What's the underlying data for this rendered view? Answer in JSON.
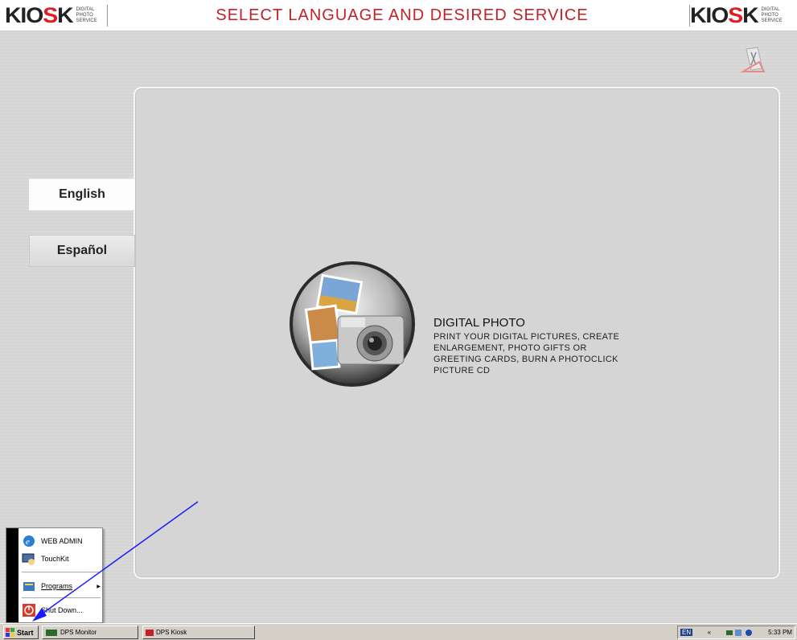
{
  "header": {
    "title": "SELECT LANGUAGE AND DESIRED SERVICE",
    "logo_word": "KIO",
    "logo_word_end": "K",
    "logo_sub": [
      "DIGITAL",
      "PHOTO",
      "SERVICE"
    ]
  },
  "languages": [
    {
      "label": "English",
      "selected": true
    },
    {
      "label": "Español",
      "selected": false
    }
  ],
  "service": {
    "title": "DIGITAL PHOTO",
    "description": "PRINT YOUR DIGITAL PICTURES, CREATE ENLARGEMENT, PHOTO GIFTS OR GREETING CARDS, BURN A PHOTOCLICK PICTURE CD"
  },
  "start_menu": {
    "items": [
      {
        "label": "WEB ADMIN",
        "icon": "ie-icon"
      },
      {
        "label": "TouchKit",
        "icon": "touchkit-icon"
      },
      {
        "label": "Programs",
        "icon": "programs-icon"
      },
      {
        "label": "Shut Down...",
        "icon": "shutdown-icon"
      }
    ]
  },
  "taskbar": {
    "start_label": "Start",
    "tasks": [
      "DPS Monitor",
      "DPS Kiosk"
    ],
    "lang_indicator": "EN",
    "clock": "5:33 PM"
  },
  "colors": {
    "accent_red": "#c42026",
    "arrow_blue": "#1a1aff"
  }
}
